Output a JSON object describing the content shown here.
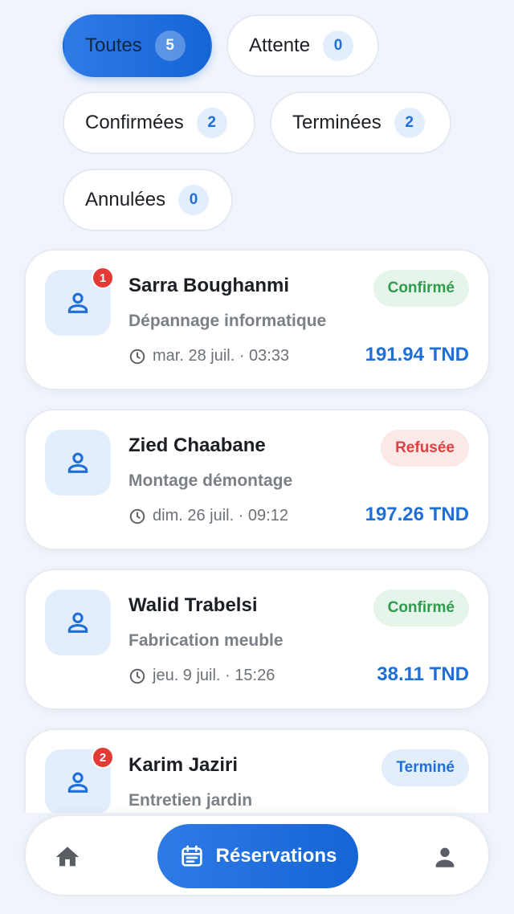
{
  "filters": [
    {
      "label": "Toutes",
      "count": "5"
    },
    {
      "label": "Attente",
      "count": "0"
    },
    {
      "label": "Confirmées",
      "count": "2"
    },
    {
      "label": "Terminées",
      "count": "2"
    },
    {
      "label": "Annulées",
      "count": "0"
    }
  ],
  "reservations": [
    {
      "name": "Sarra Boughanmi",
      "service": "Dépannage informatique",
      "date": "mar. 28 juil. · 03:33",
      "status": "Confirmé",
      "price": "191.94 TND",
      "badge": "1"
    },
    {
      "name": "Zied Chaabane",
      "service": "Montage démontage",
      "date": "dim. 26 juil. · 09:12",
      "status": "Refusée",
      "price": "197.26 TND"
    },
    {
      "name": "Walid Trabelsi",
      "service": "Fabrication meuble",
      "date": "jeu. 9 juil. · 15:26",
      "status": "Confirmé",
      "price": "38.11 TND"
    },
    {
      "name": "Karim Jaziri",
      "service": "Entretien jardin",
      "status": "Terminé",
      "badge": "2"
    }
  ],
  "nav": {
    "active_label": "Réservations"
  },
  "colors": {
    "accent": "#1f6fd9",
    "confirmed_bg": "#e6f5ea",
    "confirmed_text": "#2e9b4e",
    "refused_bg": "#fde8e8",
    "refused_text": "#e04040",
    "done_bg": "#e3eefc",
    "done_text": "#1f6fd9",
    "badge": "#e53935"
  },
  "icons": {
    "avatar": "person-outline-icon",
    "clock": "clock-icon",
    "home": "home-icon",
    "calendar": "calendar-icon",
    "profile": "person-icon"
  }
}
